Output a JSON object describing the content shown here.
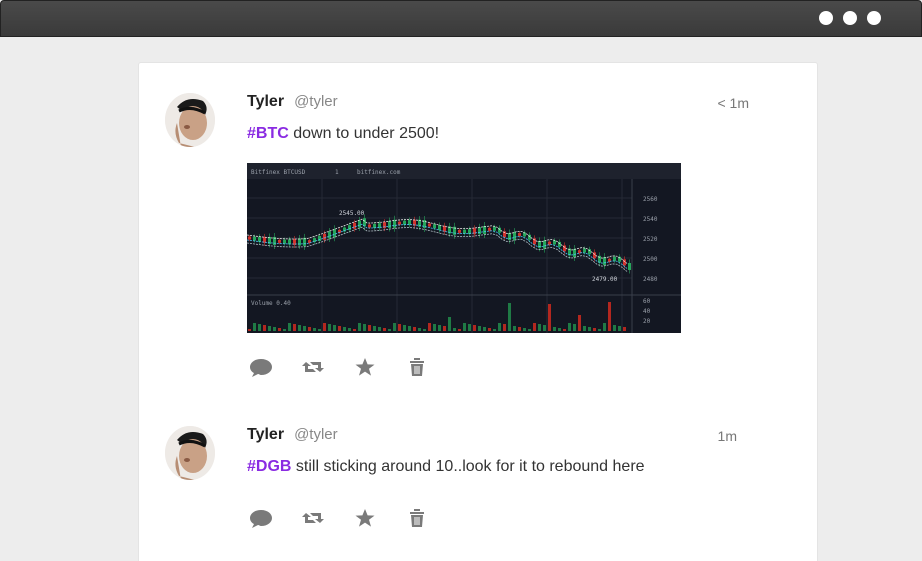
{
  "window": {
    "controls": [
      "menu-dot",
      "menu-dot",
      "menu-dot"
    ]
  },
  "tweets": [
    {
      "name": "Tyler",
      "handle": "@tyler",
      "time": "< 1m",
      "hashtag": "#BTC",
      "text": " down to under 2500!",
      "has_image": true,
      "chart_header": {
        "symbol": "Bitfinex BTCUSD",
        "interval": "1",
        "source": "bitfinex.com",
        "value_label": "2545.00",
        "low_label": "2479.00",
        "volume_label": "Volume 0.40"
      },
      "price_ticks": [
        "2560",
        "2540",
        "2520",
        "2500",
        "2480"
      ],
      "volume_ticks": [
        "60",
        "40",
        "20"
      ]
    },
    {
      "name": "Tyler",
      "handle": "@tyler",
      "time": "1m",
      "hashtag": "#DGB",
      "text": " still sticking around 10..look for it to rebound here",
      "has_image": false
    }
  ],
  "colors": {
    "hashtag": "#8a2be2",
    "icon": "#7a7a7a"
  },
  "action_icons": [
    "reply-icon",
    "retweet-icon",
    "favorite-icon",
    "delete-icon"
  ]
}
